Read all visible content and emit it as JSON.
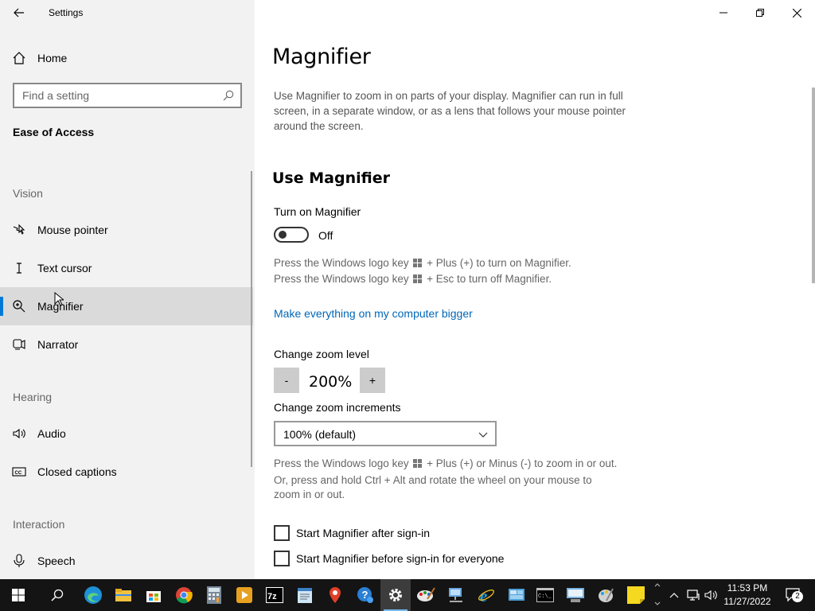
{
  "window": {
    "title": "Settings"
  },
  "sidebar": {
    "home_label": "Home",
    "search_placeholder": "Find a setting",
    "section_title": "Ease of Access",
    "groups": {
      "vision": "Vision",
      "hearing": "Hearing",
      "interaction": "Interaction"
    },
    "items": [
      {
        "label": "Mouse pointer",
        "icon": "mouse-pointer-icon"
      },
      {
        "label": "Text cursor",
        "icon": "text-cursor-icon"
      },
      {
        "label": "Magnifier",
        "icon": "magnifier-icon",
        "selected": true
      },
      {
        "label": "Narrator",
        "icon": "narrator-icon"
      },
      {
        "label": "Audio",
        "icon": "audio-icon"
      },
      {
        "label": "Closed captions",
        "icon": "closed-captions-icon"
      },
      {
        "label": "Speech",
        "icon": "speech-icon"
      }
    ]
  },
  "main": {
    "title": "Magnifier",
    "description": "Use Magnifier to zoom in on parts of your display. Magnifier can run in full screen, in a separate window, or as a lens that follows your mouse pointer around the screen.",
    "use_heading": "Use Magnifier",
    "turn_on_label": "Turn on Magnifier",
    "toggle_state": "Off",
    "hint_on_a": "Press the Windows logo key",
    "hint_on_b": "+ Plus (+) to turn on Magnifier.",
    "hint_off_a": "Press the Windows logo key",
    "hint_off_b": "+ Esc to turn off Magnifier.",
    "link_bigger": "Make everything on my computer bigger",
    "zoom_level_label": "Change zoom level",
    "zoom_minus": "-",
    "zoom_value": "200%",
    "zoom_plus": "+",
    "increments_label": "Change zoom increments",
    "increments_value": "100% (default)",
    "zoom_hint_a": "Press the Windows logo key",
    "zoom_hint_b": "+ Plus (+) or Minus (-) to zoom in or out.",
    "zoom_hint_c": "Or, press and hold Ctrl + Alt and rotate the wheel on your mouse to",
    "zoom_hint_d": "zoom in or out.",
    "check_after_signin": "Start Magnifier after sign-in",
    "check_before_signin": "Start Magnifier before sign-in for everyone"
  },
  "taskbar": {
    "apps": [
      "start-icon",
      "search-icon",
      "edge-icon",
      "file-explorer-icon",
      "store-icon",
      "chrome-icon",
      "calculator-icon",
      "media-player-icon",
      "7zip-icon",
      "notepad-icon",
      "maps-icon",
      "help-icon",
      "settings-icon",
      "paint-icon",
      "network-icon",
      "ie-icon",
      "remote-desktop-icon",
      "cmd-icon",
      "computer-icon",
      "paint3d-icon",
      "sticky-notes-icon"
    ],
    "time": "11:53 PM",
    "date": "11/27/2022",
    "notification_count": "2"
  },
  "colors": {
    "accent": "#0078d7",
    "link": "#0067b8",
    "sidebar_bg": "#f2f2f2",
    "taskbar_bg": "#141414"
  }
}
